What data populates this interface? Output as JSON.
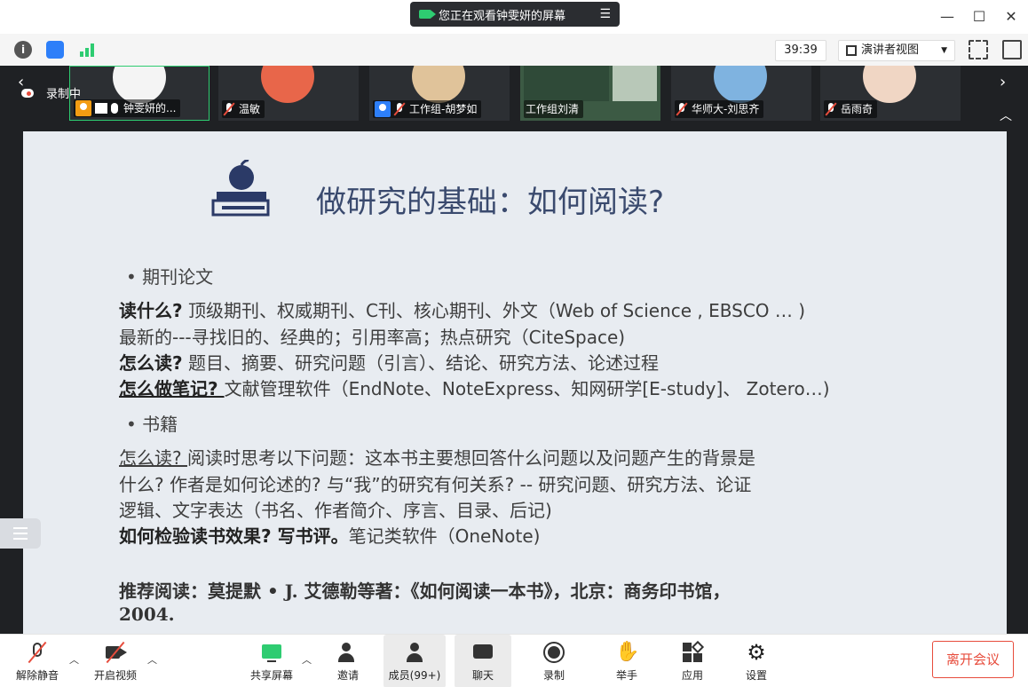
{
  "titlebar": {
    "sharing_text": "您正在观看钟雯妍的屏幕",
    "minimize": "—",
    "maximize": "☐",
    "close": "✕"
  },
  "infobar": {
    "timer": "39:39",
    "view_label": "演讲者视图"
  },
  "strip": {
    "recording_label": "录制中",
    "participants": [
      {
        "name": "钟雯妍的..."
      },
      {
        "name": "温敏"
      },
      {
        "name": "工作组-胡梦如"
      },
      {
        "name": "工作组刘清"
      },
      {
        "name": "华师大-刘思齐"
      },
      {
        "name": "岳雨奇"
      }
    ]
  },
  "slide": {
    "title": "做研究的基础：如何阅读?",
    "bullet1": "• 期刊论文",
    "l1_bold": "读什么?",
    "l1_rest": " 顶级期刊、权威期刊、C刊、核心期刊、外文（Web of Science , EBSCO … )",
    "l2": "最新的---寻找旧的、经典的；引用率高；热点研究（CiteSpace)",
    "l3_bold": "怎么读?",
    "l3_rest": " 题目、摘要、研究问题（引言）、结论、研究方法、论述过程",
    "l4_bold": "怎么做笔记? ",
    "l4_rest": "文献管理软件（EndNote、NoteExpress、知网研学[E-study]、 Zotero…)",
    "bullet2": "• 书籍",
    "l5_u": "怎么读? ",
    "l5_rest": "阅读时思考以下问题：这本书主要想回答什么问题以及问题产生的背景是",
    "l6": "什么? 作者是如何论述的? 与“我”的研究有何关系? -- 研究问题、研究方法、论证",
    "l7": "逻辑、文字表达（书名、作者简介、序言、目录、后记)",
    "l8_bold": "如何检验读书效果? 写书评。",
    "l8_rest": "笔记类软件（OneNote)",
    "l9": "推荐阅读：莫提默 • J. 艾德勒等著：《如何阅读一本书》，北京：商务印书馆，",
    "l10": "2004."
  },
  "toolbar": {
    "mute": "解除静音",
    "video": "开启视频",
    "share": "共享屏幕",
    "invite": "邀请",
    "members": "成员(99+)",
    "chat": "聊天",
    "record": "录制",
    "raise_hand": "举手",
    "apps": "应用",
    "settings": "设置",
    "leave": "离开会议"
  }
}
